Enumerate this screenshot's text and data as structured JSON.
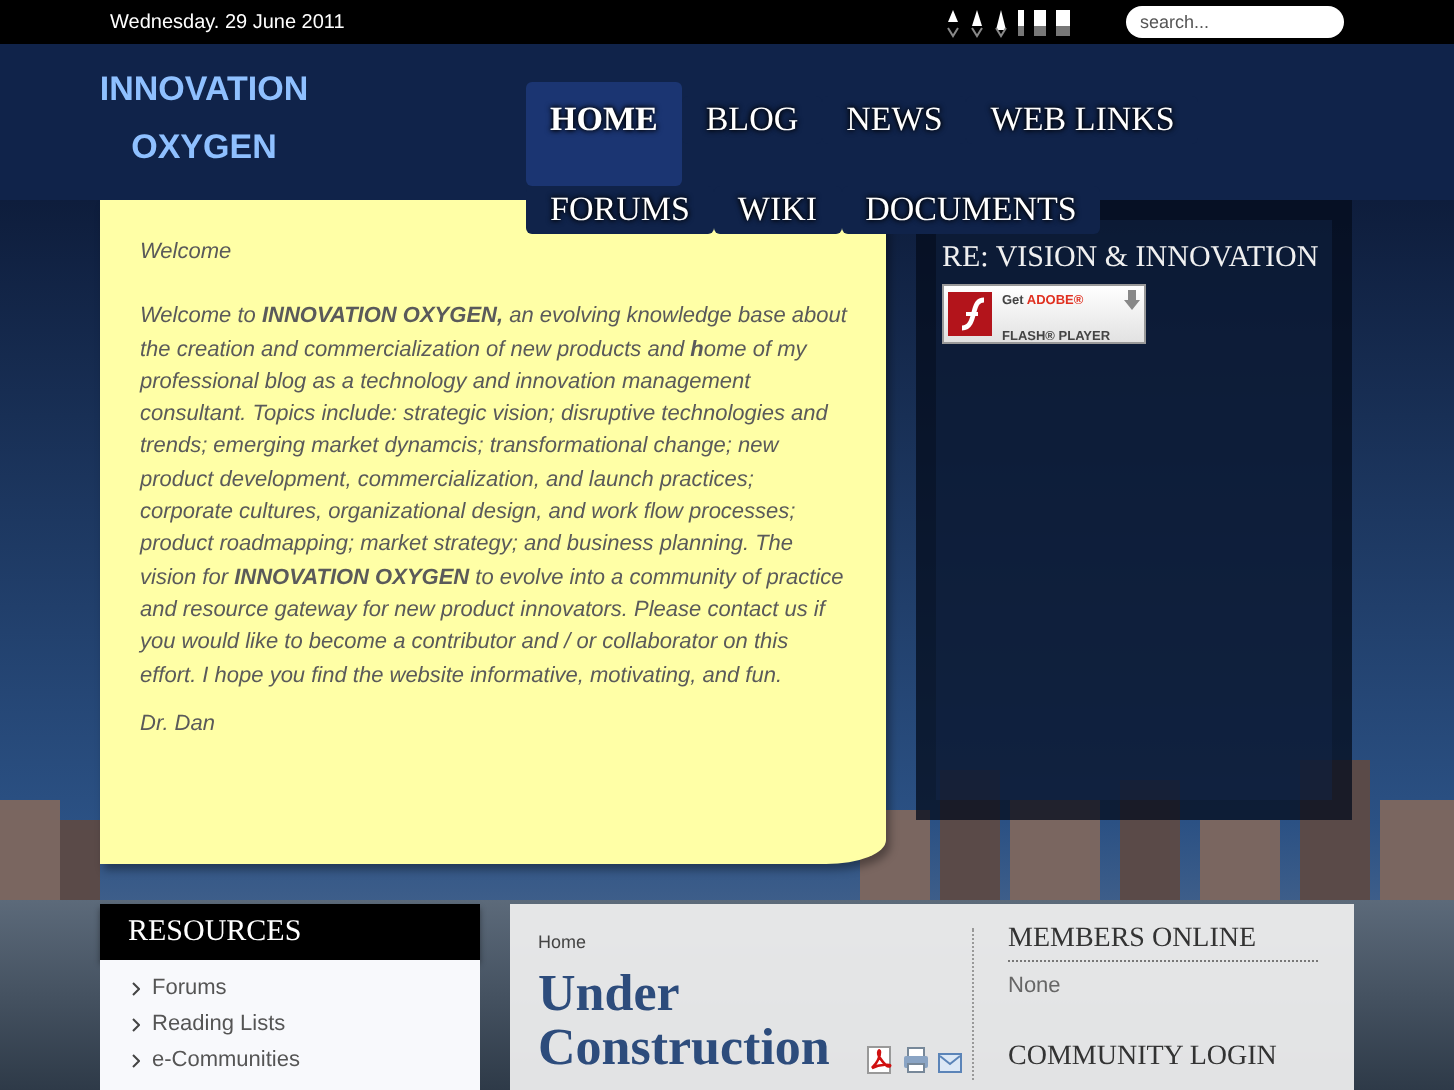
{
  "top_bar": {
    "date": "Wednesday. 29 June 2011",
    "search": {
      "placeholder": "search..."
    }
  },
  "site_title": "INNOVATION OXYGEN",
  "nav": [
    {
      "label": "HOME",
      "selected": true
    },
    {
      "label": "BLOG",
      "selected": false
    },
    {
      "label": "NEWS",
      "selected": false
    },
    {
      "label": "WEB LINKS",
      "selected": false
    },
    {
      "label": "FORUMS",
      "selected": false
    },
    {
      "label": "WIKI",
      "selected": false
    },
    {
      "label": "DOCUMENTS",
      "selected": false
    }
  ],
  "welcome": {
    "heading": "Welcome",
    "body": "Welcome to **INNOVATION OXYGEN,** an evolving knowledge base about the creation and commercialization of new products and **h**ome of my professional blog as a technology and innovation management consultant. Topics include: strategic vision; disruptive technologies and trends; emerging market dynamcis; transformational change; new product development, commercialization, and launch practices; corporate cultures, organizational design, and work flow processes; product roadmapping; market strategy; and business planning. The vision for **INNOVATION OXYGEN** to evolve into a community of practice and resource gateway for new product innovators. Please contact us if you would like to become a contributor and / or collaborator on this effort. I hope you find the website informative, motivating, and fun.",
    "signature": "Dr. Dan"
  },
  "media_panel": {
    "title": "RE: VISION & INNOVATION",
    "flash_badge": {
      "prefix": "Get",
      "brand": "ADOBE®",
      "line_2": "FLASH® PLAYER"
    }
  },
  "resources": {
    "title": "RESOURCES",
    "items": [
      "Forums",
      "Reading Lists",
      "e-Communities"
    ]
  },
  "article": {
    "breadcrumb": "Home",
    "title": "Under Construction"
  },
  "sidebar": {
    "sections": [
      {
        "title": "MEMBERS ONLINE",
        "text": "None"
      },
      {
        "title": "COMMUNITY LOGIN"
      }
    ]
  }
}
